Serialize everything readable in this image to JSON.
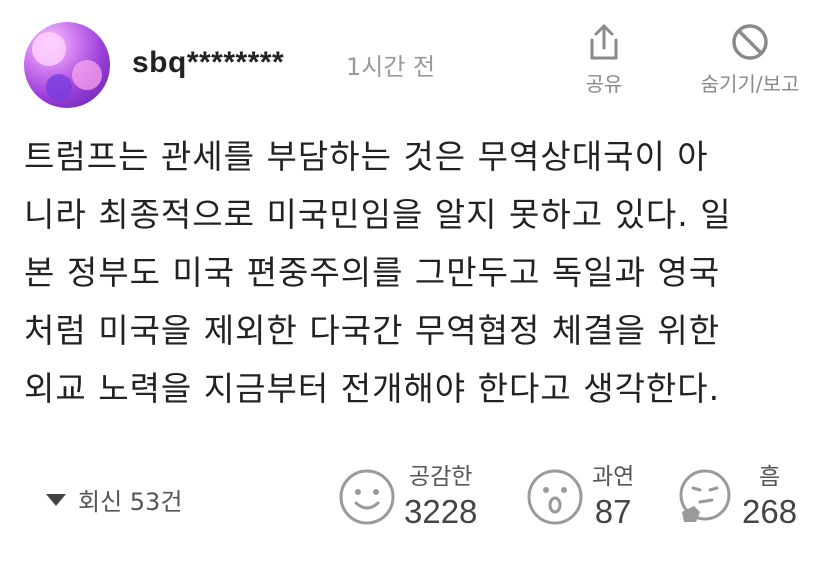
{
  "comment": {
    "username": "sbq********",
    "timestamp": "1시간 전",
    "actions": {
      "share_label": "공유",
      "hide_report_label": "숨기기/보고"
    },
    "body_lines": [
      "트럼프는 관세를 부담하는 것은 무역상대국이 아",
      "니라 최종적으로 미국민임을 알지 못하고 있다. 일",
      "본 정부도 미국 편중주의를 그만두고 독일과 영국",
      "처럼 미국을 제외한 다국간 무역협정 체결을 위한",
      "외교 노력을 지금부터 전개해야 한다고 생각한다."
    ],
    "replies_label": "회신 53건",
    "reactions": [
      {
        "label": "공감한",
        "count": "3228",
        "icon": "smile-face-icon"
      },
      {
        "label": "과연",
        "count": "87",
        "icon": "surprised-face-icon"
      },
      {
        "label": "흠",
        "count": "268",
        "icon": "thinking-face-icon"
      }
    ]
  },
  "colors": {
    "text": "#222222",
    "muted": "#9a9a9a",
    "icon": "#8a8a8a"
  }
}
